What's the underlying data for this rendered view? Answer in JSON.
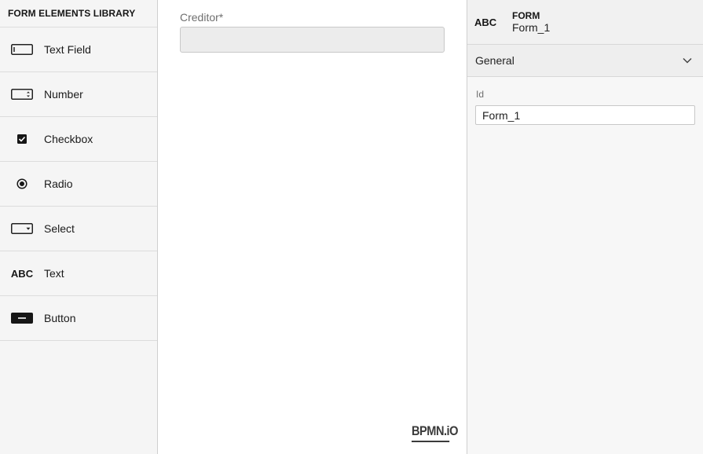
{
  "palette": {
    "title": "FORM ELEMENTS LIBRARY",
    "entries": [
      {
        "label": "Text Field",
        "icon": "textfield-icon"
      },
      {
        "label": "Number",
        "icon": "number-icon"
      },
      {
        "label": "Checkbox",
        "icon": "checkbox-icon"
      },
      {
        "label": "Radio",
        "icon": "radio-icon"
      },
      {
        "label": "Select",
        "icon": "select-icon"
      },
      {
        "label": "Text",
        "icon": "text-icon",
        "icon_text": "ABC"
      },
      {
        "label": "Button",
        "icon": "button-icon"
      }
    ]
  },
  "canvas": {
    "field": {
      "label": "Creditor*",
      "value": ""
    },
    "powered_by": "BPMN.iO"
  },
  "properties": {
    "header": {
      "icon_text": "ABC",
      "type": "FORM",
      "name": "Form_1"
    },
    "group": {
      "title": "General",
      "expanded": true
    },
    "entry": {
      "label": "Id",
      "value": "Form_1"
    }
  }
}
